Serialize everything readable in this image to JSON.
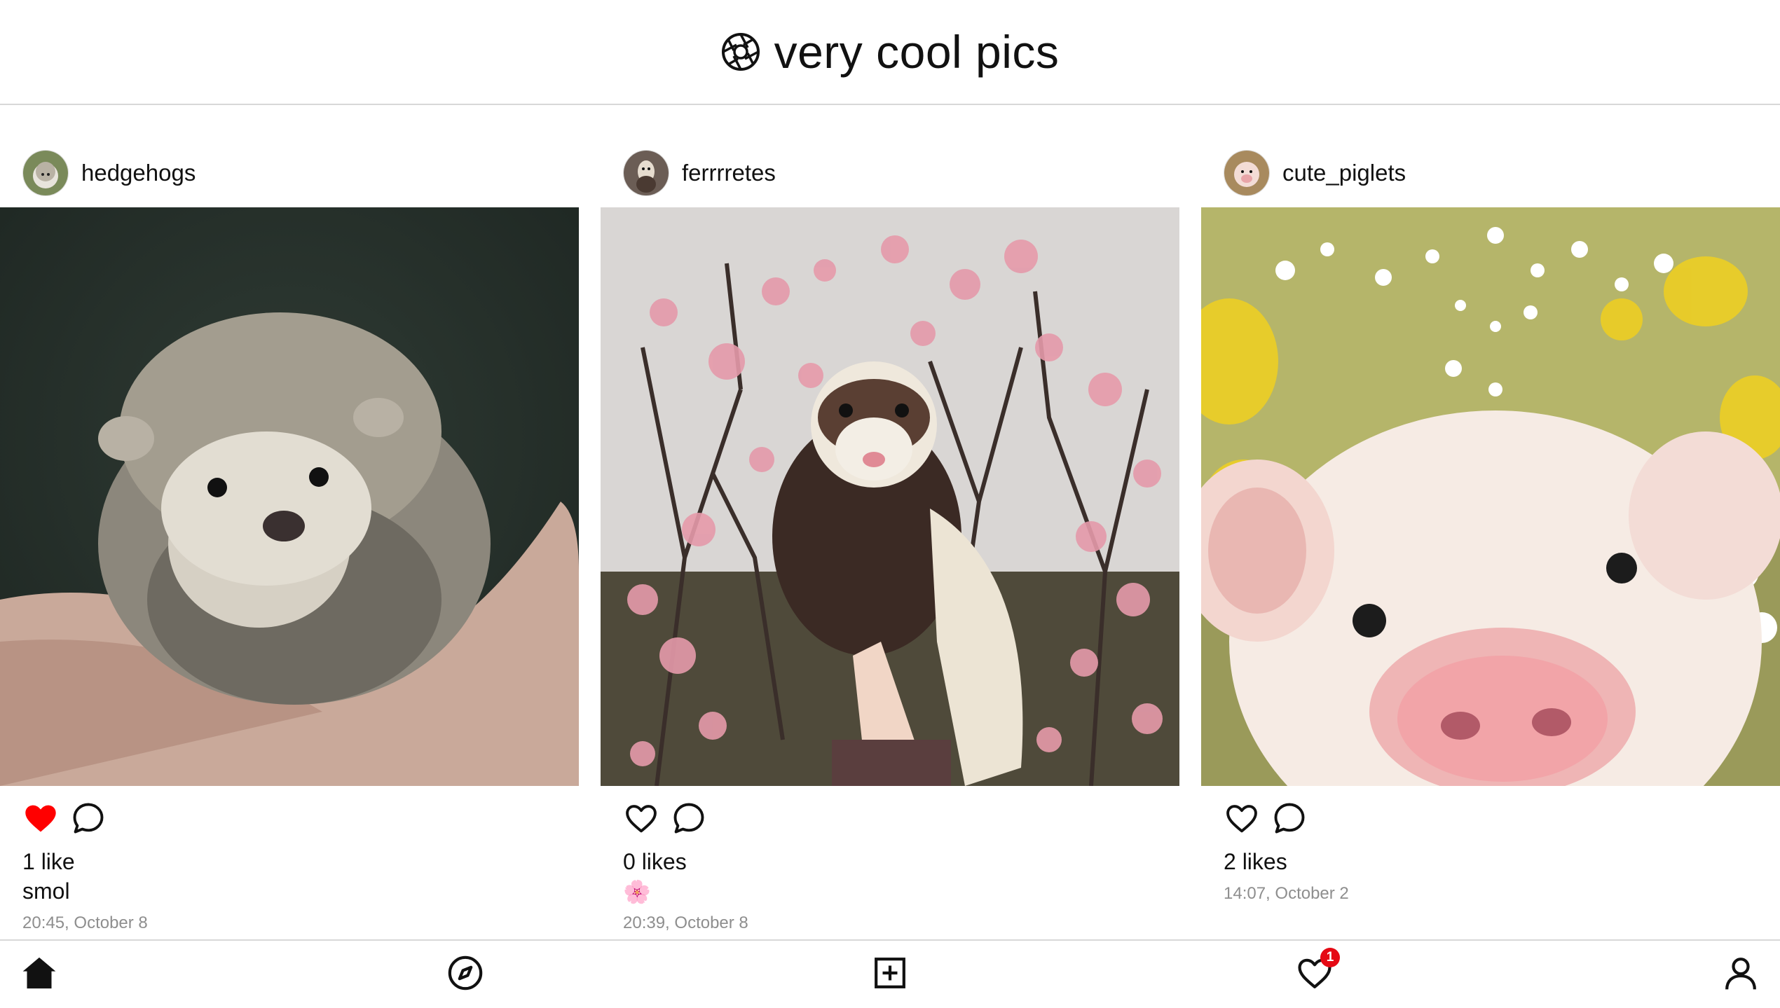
{
  "header": {
    "title": "very cool pics",
    "logo_icon": "camera-aperture-icon"
  },
  "posts": [
    {
      "username": "hedgehogs",
      "liked": true,
      "likes_text": "1 like",
      "caption": "smol",
      "timestamp": "20:45, October 8"
    },
    {
      "username": "ferrrretes",
      "liked": false,
      "likes_text": "0 likes",
      "caption": "🌸",
      "timestamp": "20:39, October 8"
    },
    {
      "username": "cute_piglets",
      "liked": false,
      "likes_text": "2 likes",
      "caption": "",
      "timestamp": "14:07, October 2"
    }
  ],
  "bottom_nav": {
    "items": [
      "home-icon",
      "explore-compass-icon",
      "new-post-icon",
      "activity-heart-icon",
      "profile-icon"
    ],
    "activity_badge": "1"
  },
  "colors": {
    "like_red": "#ff0000",
    "badge_red": "#e50914",
    "timestamp_gray": "#8e8e8e",
    "divider": "#d8d8d8"
  }
}
